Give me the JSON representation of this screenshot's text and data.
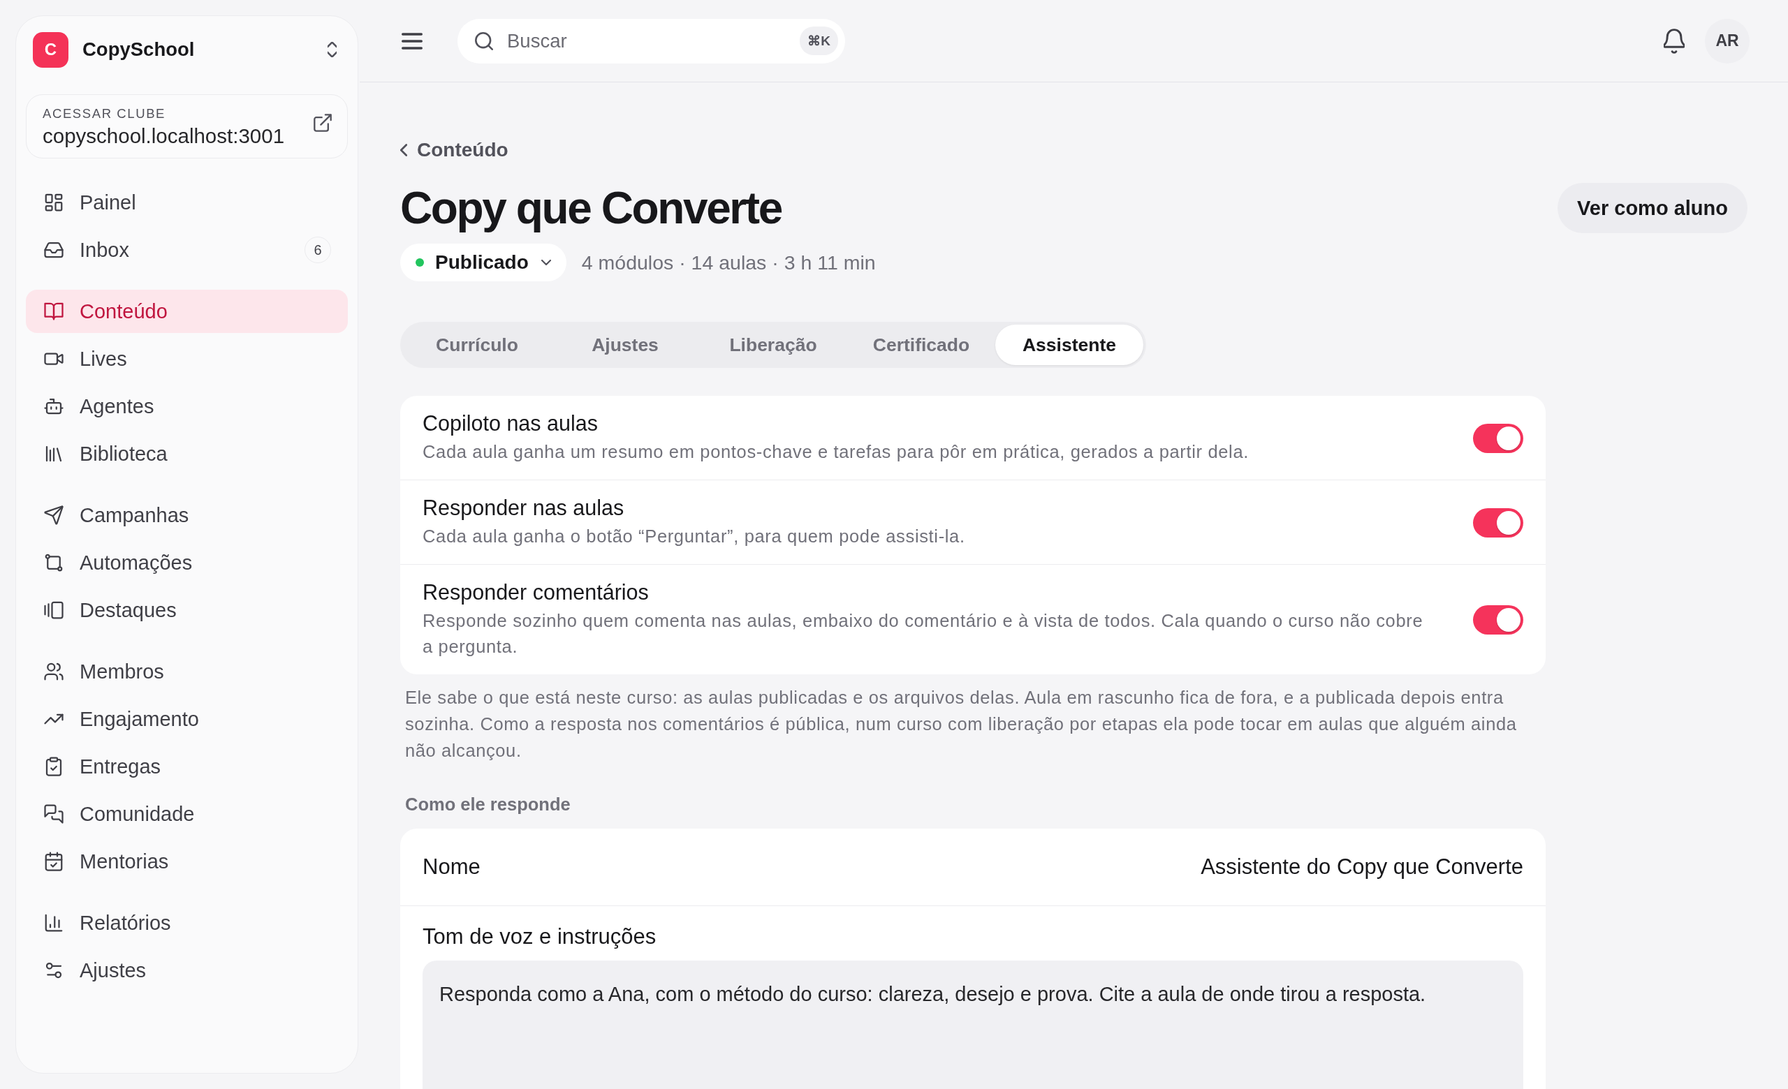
{
  "sidebar": {
    "brand": {
      "logo_letter": "C",
      "name": "CopySchool"
    },
    "club_link": {
      "label": "ACESSAR CLUBE",
      "url": "copyschool.localhost:3001"
    },
    "nav_groups": [
      {
        "items": [
          {
            "label": "Painel",
            "selected": false
          },
          {
            "label": "Inbox",
            "selected": false,
            "badge": "6"
          }
        ]
      },
      {
        "items": [
          {
            "label": "Conteúdo",
            "selected": true
          },
          {
            "label": "Lives",
            "selected": false
          },
          {
            "label": "Agentes",
            "selected": false
          },
          {
            "label": "Biblioteca",
            "selected": false
          }
        ]
      },
      {
        "items": [
          {
            "label": "Campanhas",
            "selected": false
          },
          {
            "label": "Automações",
            "selected": false
          },
          {
            "label": "Destaques",
            "selected": false
          }
        ]
      },
      {
        "items": [
          {
            "label": "Membros",
            "selected": false
          },
          {
            "label": "Engajamento",
            "selected": false
          },
          {
            "label": "Entregas",
            "selected": false
          },
          {
            "label": "Comunidade",
            "selected": false
          },
          {
            "label": "Mentorias",
            "selected": false
          }
        ]
      },
      {
        "items": [
          {
            "label": "Relatórios",
            "selected": false
          },
          {
            "label": "Ajustes",
            "selected": false
          }
        ]
      }
    ]
  },
  "top_bar": {
    "search": {
      "placeholder": "Buscar",
      "shortcut": "⌘K"
    },
    "avatar": {
      "initials": "AR"
    }
  },
  "header": {
    "breadcrumb": "Conteúdo",
    "title": "Copy que Converte",
    "status": "Publicado",
    "meta": "4 módulos · 14 aulas · 3 h 11 min",
    "action_button": "Ver como aluno"
  },
  "tabs": [
    {
      "label": "Currículo",
      "selected": false
    },
    {
      "label": "Ajustes",
      "selected": false
    },
    {
      "label": "Liberação",
      "selected": false
    },
    {
      "label": "Certificado",
      "selected": false
    },
    {
      "label": "Assistente",
      "selected": true
    }
  ],
  "assistant_toggles": [
    {
      "title": "Copiloto nas aulas",
      "description": "Cada aula ganha um resumo em pontos-chave e tarefas para pôr em prática, gerados a partir dela.",
      "on": true
    },
    {
      "title": "Responder nas aulas",
      "description": "Cada aula ganha o botão “Perguntar”, para quem pode assisti-la.",
      "on": true
    },
    {
      "title": "Responder comentários",
      "description": "Responde sozinho quem comenta nas aulas, embaixo do comentário e à vista de todos. Cala quando o curso não cobre a pergunta.",
      "on": true
    }
  ],
  "note": "Ele sabe o que está neste curso: as aulas publicadas e os arquivos delas. Aula em rascunho fica de fora, e a publicada depois entra sozinha. Como a resposta nos comentários é pública, num curso com liberação por etapas ela pode tocar em aulas que alguém ainda não alcançou.",
  "response_section": {
    "heading": "Como ele responde",
    "name_field": {
      "label": "Nome",
      "value": "Assistente do Copy que Converte"
    },
    "instructions": {
      "label": "Tom de voz e instruções",
      "value": "Responda como a Ana, com o método do curso: clareza, desejo e prova. Cite a aula de onde tirou a resposta."
    }
  }
}
